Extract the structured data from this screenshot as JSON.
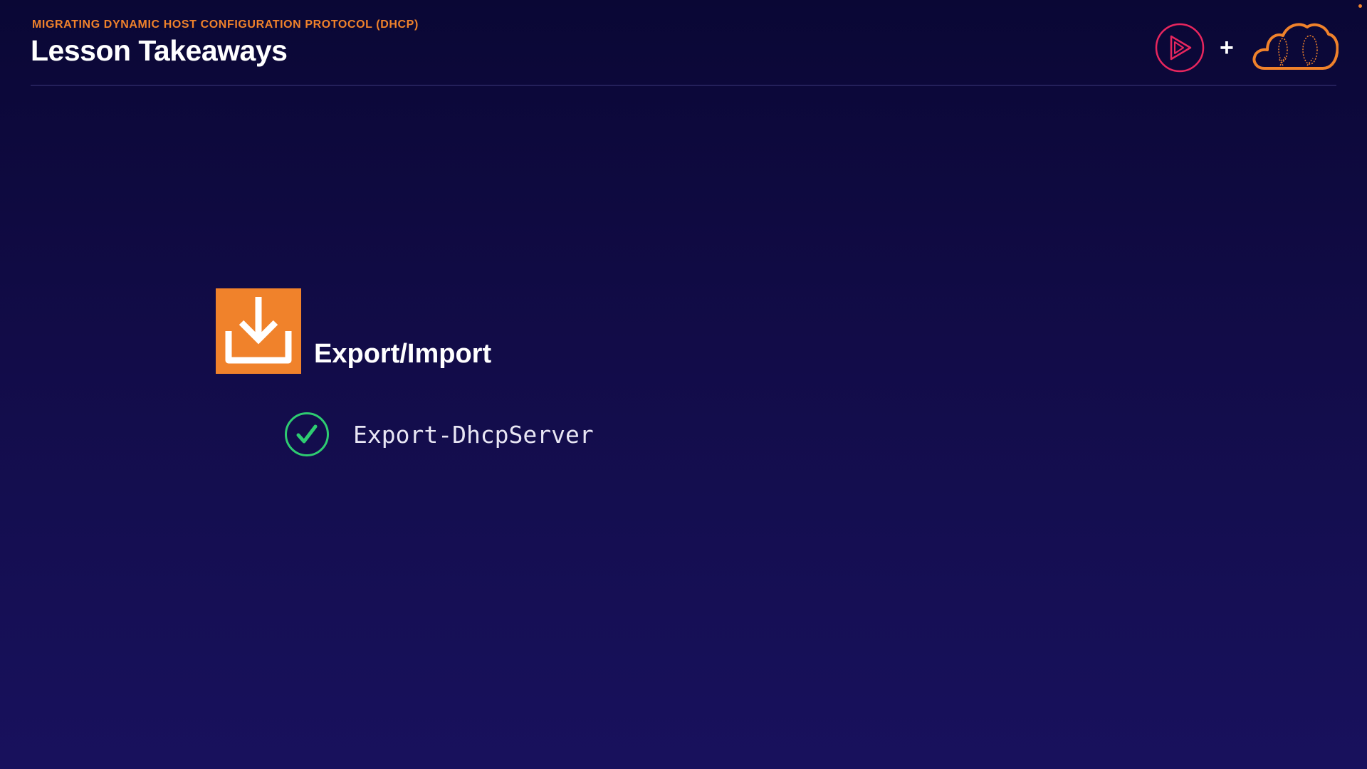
{
  "header": {
    "eyebrow": "MIGRATING DYNAMIC HOST CONFIGURATION PROTOCOL (DHCP)",
    "title": "Lesson Takeaways",
    "plus_sign": "+",
    "brand_icons": [
      "play-logo-icon",
      "cloud-logo-icon"
    ]
  },
  "colors": {
    "background_top": "#0a0735",
    "background_bottom": "#18115d",
    "accent_orange": "#f0822b",
    "play_red": "#e8265e",
    "check_green": "#2ecc71",
    "divider": "#24205a"
  },
  "content": {
    "topic": {
      "icon": "download-icon",
      "title": "Export/Import"
    },
    "items": [
      {
        "icon": "check-circle-icon",
        "text": "Export-DhcpServer"
      }
    ]
  }
}
